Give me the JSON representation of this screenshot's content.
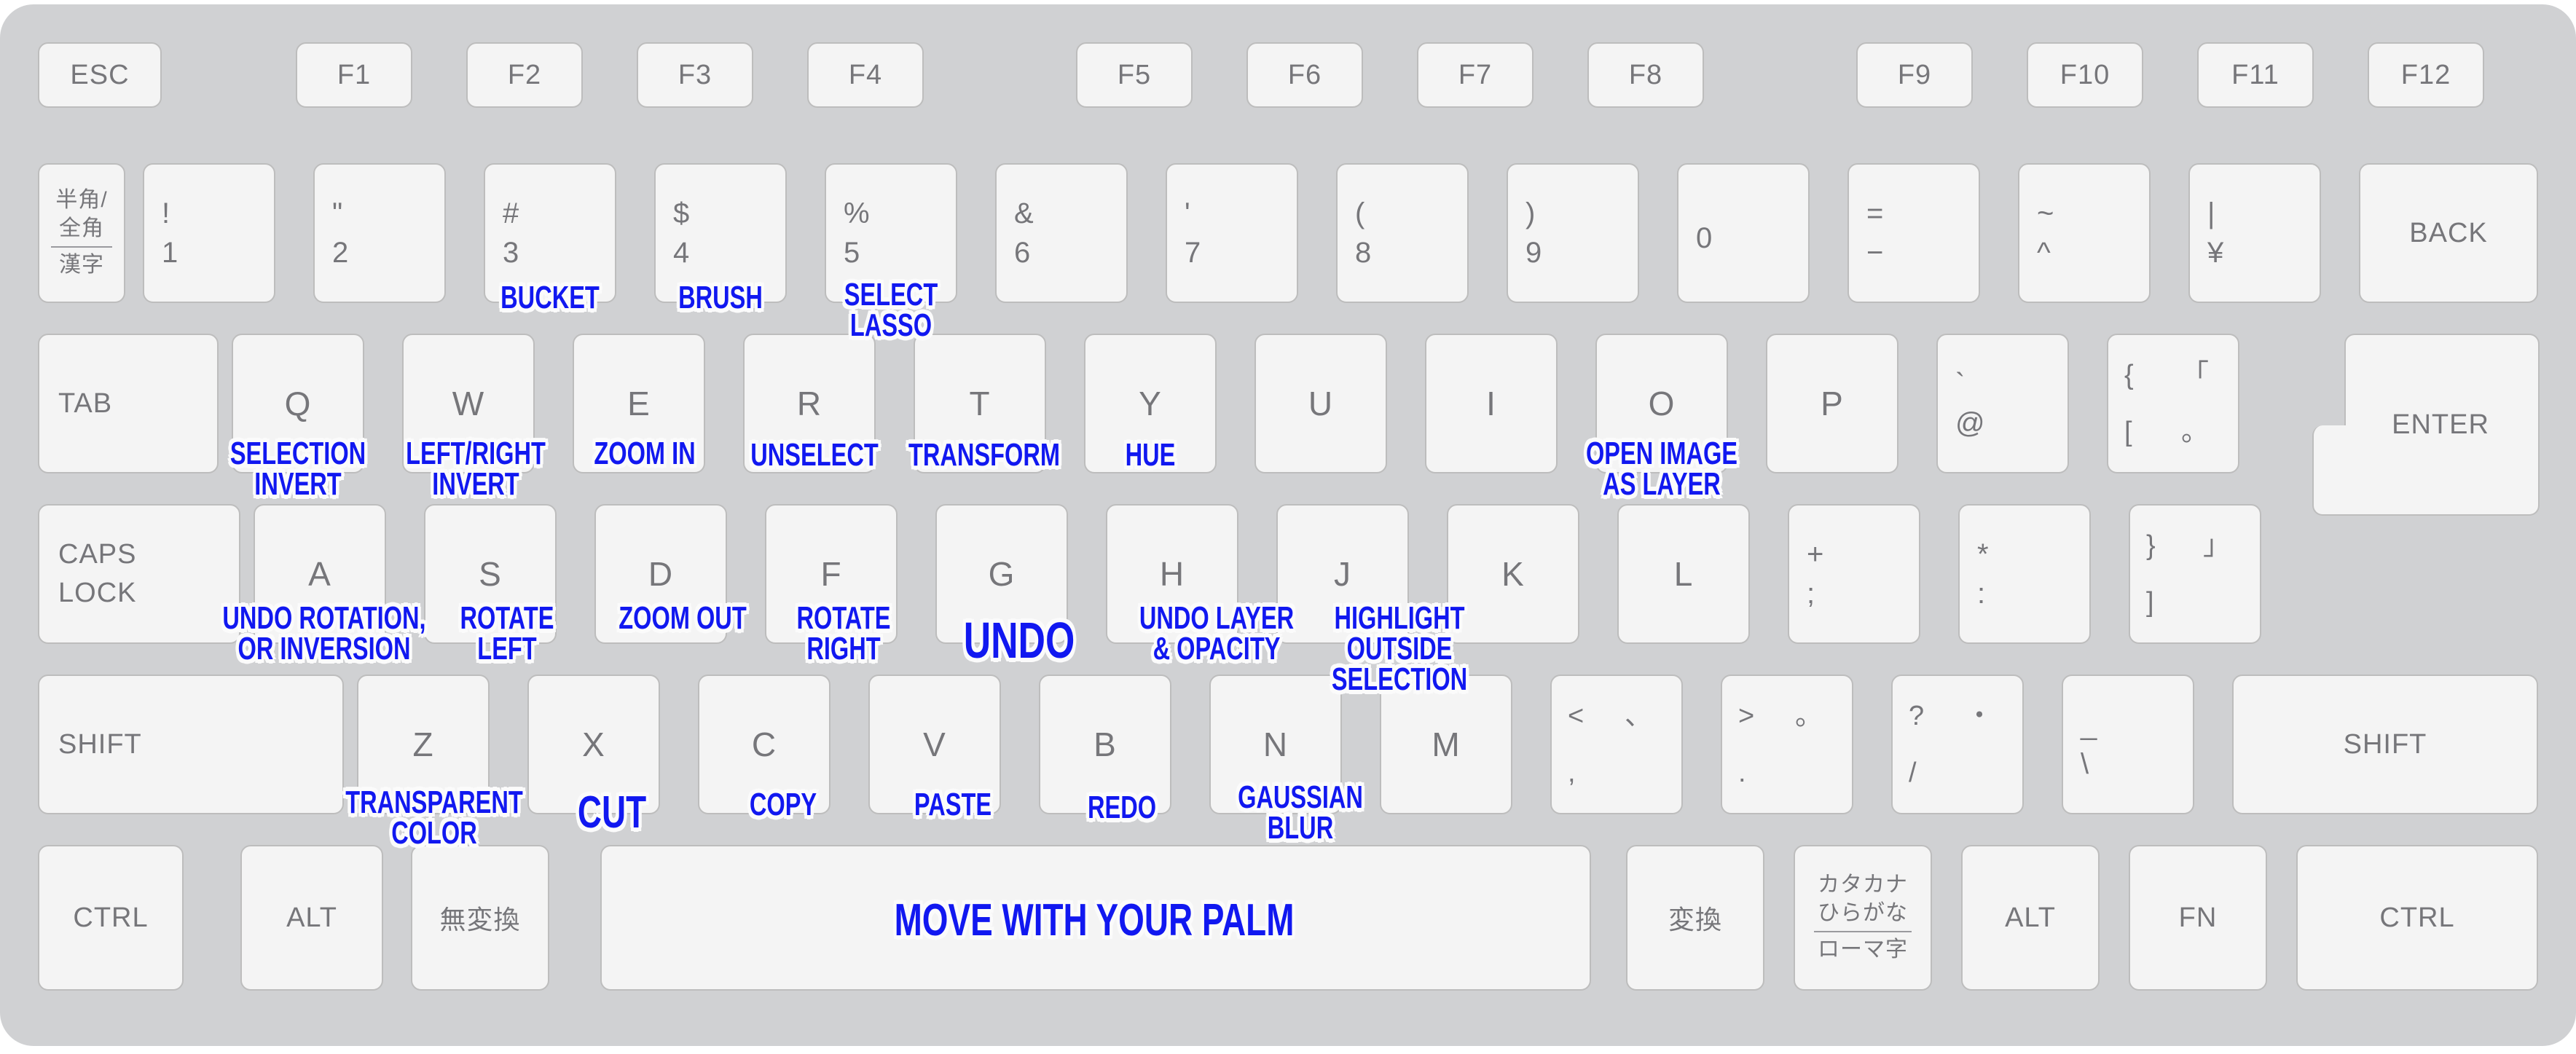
{
  "diagram": {
    "title": "Keyboard shortcut overlay",
    "annotation_color": "#1118f0",
    "key_face_color": "#f4f4f4",
    "chassis_color": "#d0d1d3",
    "legend_color": "#76767a"
  },
  "rows": {
    "function_row": [
      {
        "id": "esc",
        "label": "ESC"
      },
      {
        "id": "f1",
        "label": "F1"
      },
      {
        "id": "f2",
        "label": "F2"
      },
      {
        "id": "f3",
        "label": "F3"
      },
      {
        "id": "f4",
        "label": "F4"
      },
      {
        "id": "f5",
        "label": "F5"
      },
      {
        "id": "f6",
        "label": "F6"
      },
      {
        "id": "f7",
        "label": "F7"
      },
      {
        "id": "f8",
        "label": "F8"
      },
      {
        "id": "f9",
        "label": "F9"
      },
      {
        "id": "f10",
        "label": "F10"
      },
      {
        "id": "f11",
        "label": "F11"
      },
      {
        "id": "f12",
        "label": "F12"
      }
    ],
    "number_row": [
      {
        "id": "hankaku",
        "lines": [
          "半角/",
          "全角",
          "漢字"
        ]
      },
      {
        "id": "1",
        "top": "!",
        "bot": "1"
      },
      {
        "id": "2",
        "top": "\"",
        "bot": "2"
      },
      {
        "id": "3",
        "top": "#",
        "bot": "3"
      },
      {
        "id": "4",
        "top": "$",
        "bot": "4"
      },
      {
        "id": "5",
        "top": "%",
        "bot": "5"
      },
      {
        "id": "6",
        "top": "&",
        "bot": "6"
      },
      {
        "id": "7",
        "top": "'",
        "bot": "7"
      },
      {
        "id": "8",
        "top": "(",
        "bot": "8"
      },
      {
        "id": "9",
        "top": ")",
        "bot": "9"
      },
      {
        "id": "0",
        "top": "",
        "bot": "0"
      },
      {
        "id": "minus",
        "top": "=",
        "bot": "−"
      },
      {
        "id": "caret",
        "top": "~",
        "bot": "^"
      },
      {
        "id": "yen",
        "top": "|",
        "bot": "¥"
      },
      {
        "id": "back",
        "label": "BACK"
      }
    ],
    "tab_row": [
      {
        "id": "tab",
        "label": "TAB"
      },
      {
        "id": "q",
        "label": "Q"
      },
      {
        "id": "w",
        "label": "W"
      },
      {
        "id": "e",
        "label": "E"
      },
      {
        "id": "r",
        "label": "R"
      },
      {
        "id": "t",
        "label": "T"
      },
      {
        "id": "y",
        "label": "Y"
      },
      {
        "id": "u",
        "label": "U"
      },
      {
        "id": "i",
        "label": "I"
      },
      {
        "id": "o",
        "label": "O"
      },
      {
        "id": "p",
        "label": "P"
      },
      {
        "id": "at",
        "top": "`",
        "bot": "@"
      },
      {
        "id": "bracket-left",
        "q1": "{",
        "q2": "「",
        "q3": "[",
        "q4": "。"
      },
      {
        "id": "enter",
        "label": "ENTER"
      }
    ],
    "caps_row": [
      {
        "id": "caps",
        "lines": [
          "CAPS",
          "LOCK"
        ]
      },
      {
        "id": "a",
        "label": "A"
      },
      {
        "id": "s",
        "label": "S"
      },
      {
        "id": "d",
        "label": "D"
      },
      {
        "id": "f",
        "label": "F"
      },
      {
        "id": "g",
        "label": "G"
      },
      {
        "id": "h",
        "label": "H"
      },
      {
        "id": "j",
        "label": "J"
      },
      {
        "id": "k",
        "label": "K"
      },
      {
        "id": "l",
        "label": "L"
      },
      {
        "id": "semicolon",
        "top": "+",
        "bot": ";"
      },
      {
        "id": "colon",
        "top": "*",
        "bot": ":"
      },
      {
        "id": "bracket-right",
        "q1": "}",
        "q2": "」",
        "q3": "]",
        "q4": ""
      }
    ],
    "shift_row": [
      {
        "id": "shift-left",
        "label": "SHIFT"
      },
      {
        "id": "z",
        "label": "Z"
      },
      {
        "id": "x",
        "label": "X"
      },
      {
        "id": "c",
        "label": "C"
      },
      {
        "id": "v",
        "label": "V"
      },
      {
        "id": "b",
        "label": "B"
      },
      {
        "id": "n",
        "label": "N"
      },
      {
        "id": "m",
        "label": "M"
      },
      {
        "id": "comma",
        "q1": "<",
        "q2": "、",
        "q3": ",",
        "q4": ""
      },
      {
        "id": "period",
        "q1": ">",
        "q2": "。",
        "q3": ".",
        "q4": ""
      },
      {
        "id": "slash",
        "q1": "?",
        "q2": "・",
        "q3": "/",
        "q4": ""
      },
      {
        "id": "backslash",
        "top": "_",
        "bot": "\\"
      },
      {
        "id": "shift-right",
        "label": "SHIFT"
      }
    ],
    "bottom_row": [
      {
        "id": "ctrl-left",
        "label": "CTRL"
      },
      {
        "id": "alt-left",
        "label": "ALT"
      },
      {
        "id": "muhenkan",
        "label": "無変換"
      },
      {
        "id": "space",
        "label": ""
      },
      {
        "id": "henkan",
        "label": "変換"
      },
      {
        "id": "kana",
        "lines": [
          "カタカナ",
          "ひらがな",
          "ローマ字"
        ]
      },
      {
        "id": "alt-right",
        "label": "ALT"
      },
      {
        "id": "fn",
        "label": "FN"
      },
      {
        "id": "ctrl-right",
        "label": "CTRL"
      }
    ]
  },
  "annotations": [
    {
      "id": "bucket",
      "key": "3",
      "text": "BUCKET"
    },
    {
      "id": "brush",
      "key": "4",
      "text": "BRUSH"
    },
    {
      "id": "select-lasso",
      "key": "5",
      "text": "SELECT\nLASSO"
    },
    {
      "id": "selection-invert",
      "key": "q",
      "text": "SELECTION\nINVERT"
    },
    {
      "id": "left-right-invert",
      "key": "w",
      "text": "LEFT/RIGHT\nINVERT"
    },
    {
      "id": "zoom-in",
      "key": "e",
      "text": "ZOOM IN"
    },
    {
      "id": "unselect",
      "key": "r",
      "text": "UNSELECT"
    },
    {
      "id": "transform",
      "key": "t",
      "text": "TRANSFORM"
    },
    {
      "id": "hue",
      "key": "y",
      "text": "HUE"
    },
    {
      "id": "open-image-as-layer",
      "key": "o",
      "text": "OPEN IMAGE\nAS LAYER"
    },
    {
      "id": "undo-rotation",
      "key": "a",
      "text": "UNDO ROTATION,\nOR INVERSION"
    },
    {
      "id": "rotate-left",
      "key": "s",
      "text": "ROTATE\nLEFT"
    },
    {
      "id": "zoom-out",
      "key": "d",
      "text": "ZOOM OUT"
    },
    {
      "id": "rotate-right",
      "key": "f",
      "text": "ROTATE\nRIGHT"
    },
    {
      "id": "undo",
      "key": "g",
      "text": "UNDO"
    },
    {
      "id": "undo-layer-opacity",
      "key": "h",
      "text": "UNDO LAYER\n& OPACITY"
    },
    {
      "id": "highlight-outside-selection",
      "key": "j",
      "text": "HIGHLIGHT\nOUTSIDE\nSELECTION"
    },
    {
      "id": "transparent-color",
      "key": "z",
      "text": "TRANSPARENT\nCOLOR"
    },
    {
      "id": "cut",
      "key": "x",
      "text": "CUT"
    },
    {
      "id": "copy",
      "key": "c",
      "text": "COPY"
    },
    {
      "id": "paste",
      "key": "v",
      "text": "PASTE"
    },
    {
      "id": "redo",
      "key": "b",
      "text": "REDO"
    },
    {
      "id": "gaussian-blur",
      "key": "n",
      "text": "GAUSSIAN\nBLUR"
    },
    {
      "id": "move-with-palm",
      "key": "space",
      "text": "MOVE WITH YOUR PALM"
    }
  ]
}
